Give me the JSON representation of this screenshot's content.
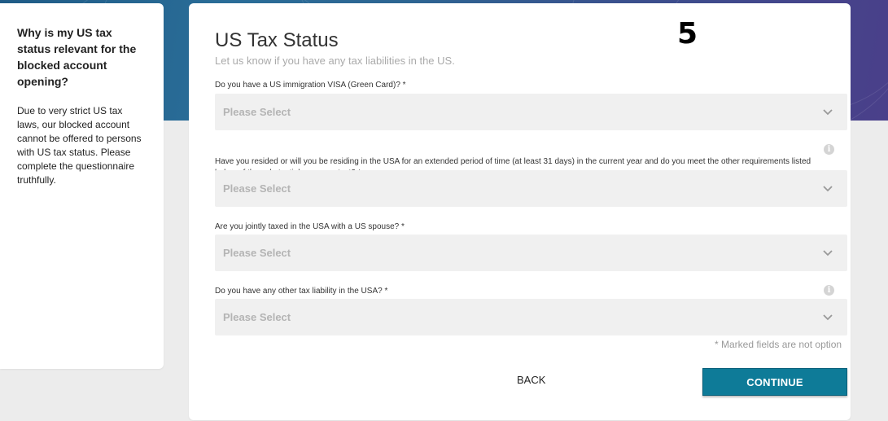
{
  "sidebar": {
    "heading": "Why is my US tax status relevant for the blocked account opening?",
    "body": "Due to very strict US tax laws, our blocked account cannot be offered to persons with US tax status. Please complete the questionnaire truthfully."
  },
  "step_marker": "5",
  "form": {
    "title": "US Tax Status",
    "subtitle": "Let us know if you have any tax liabilities in the US.",
    "questions": [
      {
        "label": "Do you have a US immigration VISA (Green Card)? *",
        "value": "Please Select",
        "has_info": false
      },
      {
        "label": "Have you resided or will you be residing in the USA for an extended period of time (at least 31 days) in the current year and do you meet the other requirements listed below of the substantial presence test? *",
        "value": "Please Select",
        "has_info": true
      },
      {
        "label": "Are you jointly taxed in the USA with a US spouse? *",
        "value": "Please Select",
        "has_info": false
      },
      {
        "label": "Do you have any other tax liability in the USA? *",
        "value": "Please Select",
        "has_info": true
      }
    ],
    "required_note": "* Marked fields are not option",
    "back_label": "BACK",
    "continue_label": "CONTINUE"
  },
  "icons": {
    "dropdown": "chevron-down-icon",
    "info": "info-icon"
  },
  "colors": {
    "primary": "#0e7b98",
    "select_bg": "#f0f0f0",
    "banner": "#2a6d98"
  }
}
